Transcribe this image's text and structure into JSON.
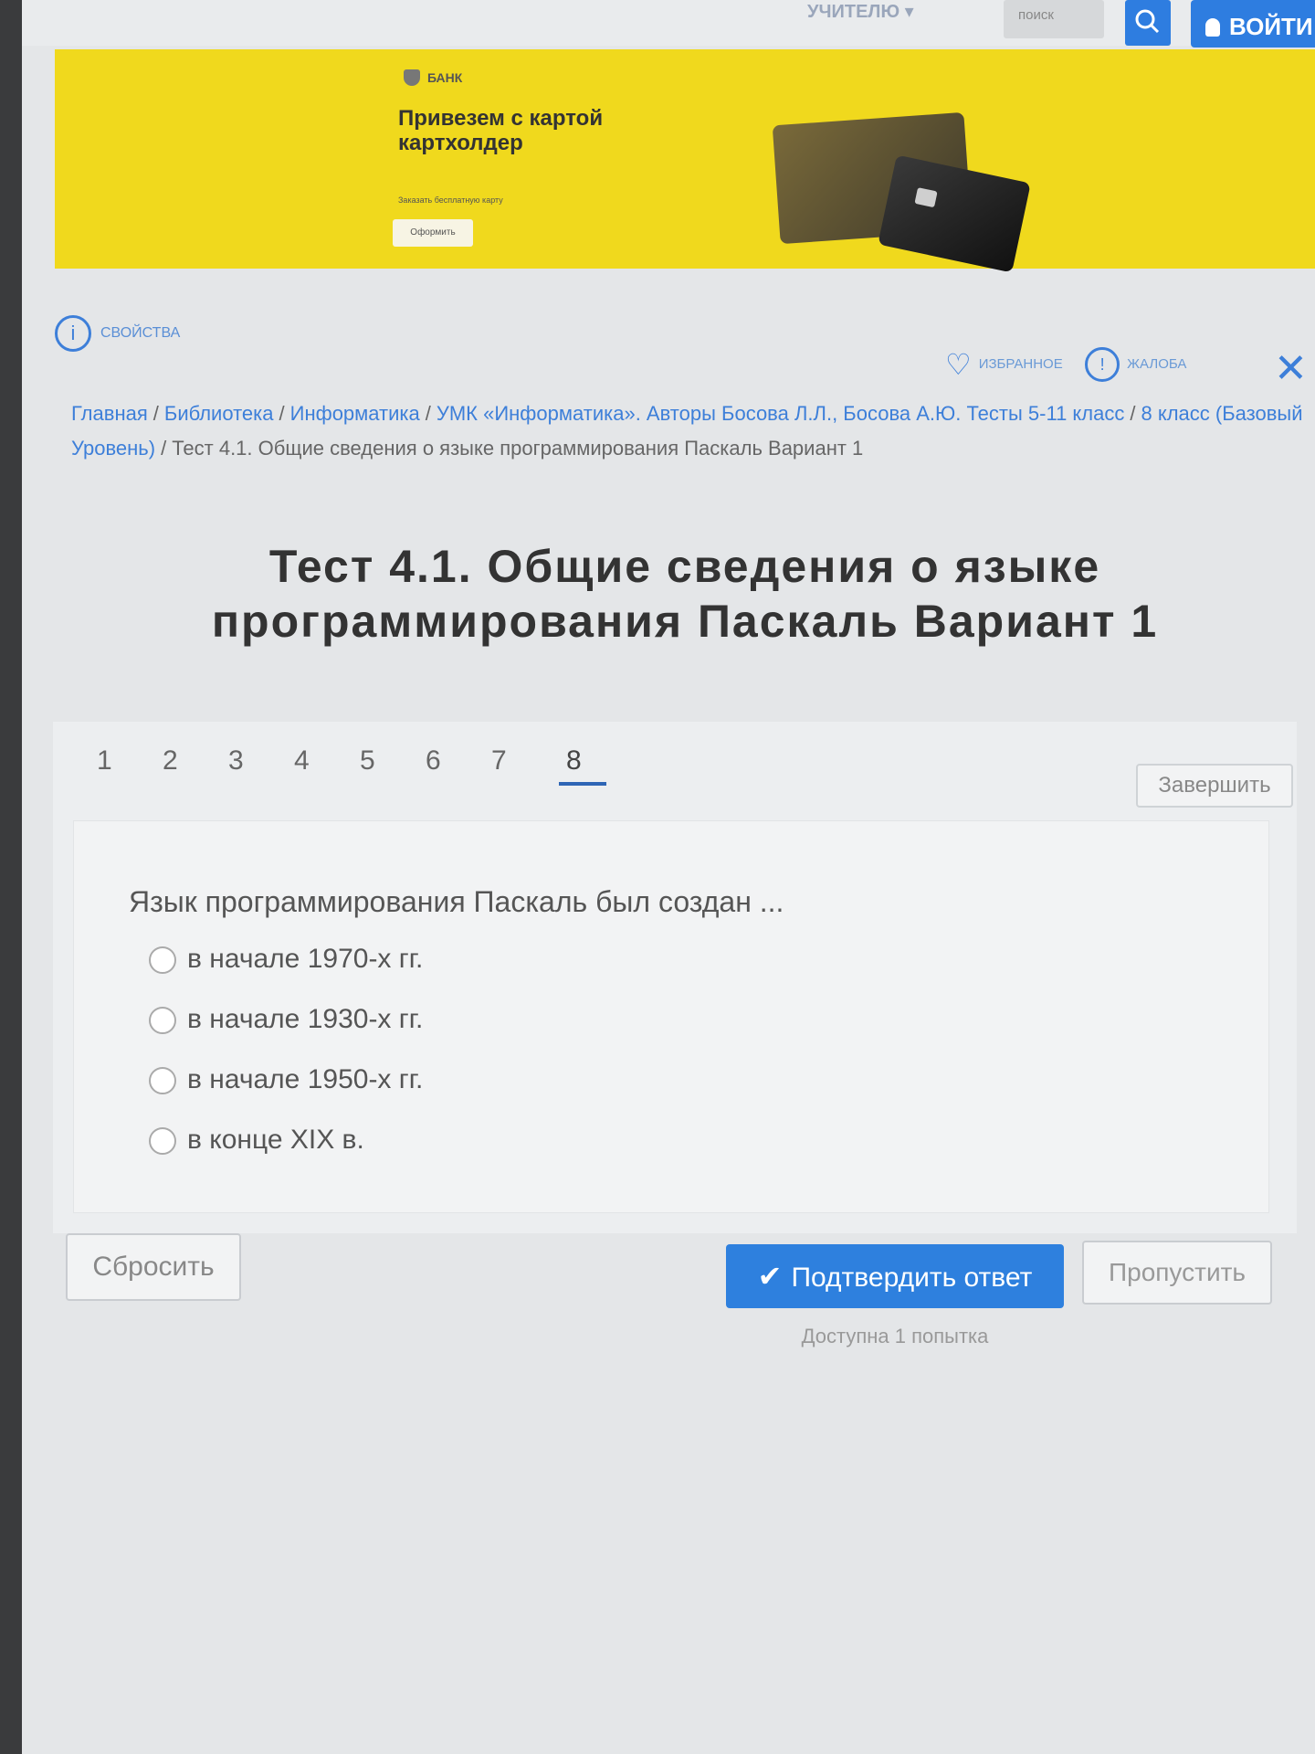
{
  "header": {
    "top_link": "УЧИТЕЛЮ ▾",
    "search_placeholder": "поиск",
    "login_label": "ВОЙТИ"
  },
  "banner": {
    "brand": "БАНК",
    "headline": "Привезем с картой картхолдер",
    "small_text": "Заказать бесплатную карту",
    "button_label": "Оформить"
  },
  "toolbar": {
    "properties_label": "СВОЙСТВА",
    "favorites_label": "ИЗБРАННОЕ",
    "complaint_label": "ЖАЛОБА"
  },
  "breadcrumb": {
    "items": [
      "Главная",
      "Библиотека",
      "Информатика",
      "УМК «Информатика». Авторы Босова Л.Л., Босова А.Ю. Тесты 5-11 класс",
      "8 класс (Базовый Уровень)"
    ],
    "current": "Тест 4.1. Общие сведения о языке программирования Паскаль Вариант 1"
  },
  "page_title": "Тест 4.1. Общие сведения о языке программирования Паскаль Вариант 1",
  "test": {
    "question_numbers": [
      "1",
      "2",
      "3",
      "4",
      "5",
      "6",
      "7",
      "8"
    ],
    "active_question": "8",
    "finish_label": "Завершить",
    "question_text": "Язык программирования Паскаль был создан ...",
    "options": [
      "в начале 1970-х гг.",
      "в начале 1930-х гг.",
      "в начале 1950-х гг.",
      "в конце XIX в."
    ],
    "reset_label": "Сбросить",
    "confirm_label": "Подтвердить ответ",
    "skip_label": "Пропустить",
    "attempts_text": "Доступна 1 попытка"
  },
  "colors": {
    "accent": "#2e80de",
    "banner": "#f0d91d",
    "link": "#3d7fd9"
  }
}
